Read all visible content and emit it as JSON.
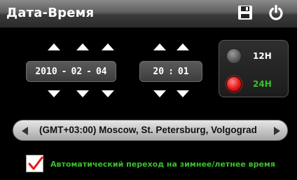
{
  "header": {
    "title": "Дата-Время",
    "save_icon": "save-icon",
    "power_icon": "power-icon"
  },
  "date": {
    "year": "2010",
    "month": "02",
    "day": "04",
    "separator": "-"
  },
  "time": {
    "hour": "20",
    "minute": "01",
    "separator": ":"
  },
  "clock_format": {
    "option_12h": "12H",
    "option_24h": "24H",
    "selected": "24H",
    "selected_color": "#e41a1a",
    "selected_label_color": "#39c02b"
  },
  "timezone": {
    "value": "(GMT+03:00) Moscow, St. Petersburg, Volgograd"
  },
  "dst": {
    "checked": true,
    "label": "Автоматический переход на зимнее/летнее время",
    "label_color": "#39c02b"
  }
}
